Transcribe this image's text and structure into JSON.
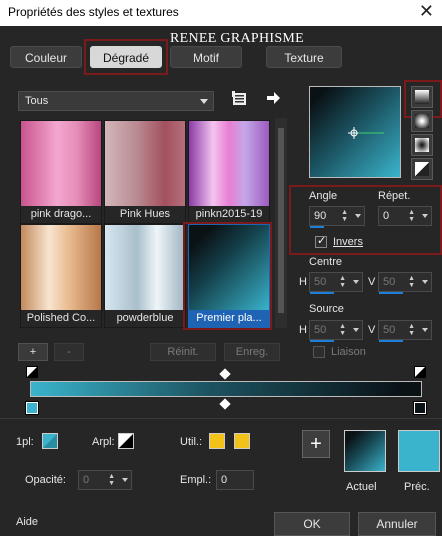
{
  "window": {
    "title": "Propriétés des styles et textures",
    "close_glyph": "✕"
  },
  "watermark": "RENEE GRAPHISME",
  "tabs": [
    {
      "label": "Couleur"
    },
    {
      "label": "Dégradé"
    },
    {
      "label": "Motif"
    },
    {
      "label": "Texture"
    }
  ],
  "category": {
    "value": "Tous"
  },
  "gradients": [
    {
      "name": "pink drago..."
    },
    {
      "name": "Pink Hues"
    },
    {
      "name": "pinkn2015-19"
    },
    {
      "name": "Polished Co..."
    },
    {
      "name": "powderblue"
    },
    {
      "name": "Premier pla..."
    }
  ],
  "gradient_buttons": {
    "add": "+",
    "remove": "-",
    "reset": "Réinit.",
    "save": "Enreg."
  },
  "angle": {
    "label": "Angle",
    "value": "90"
  },
  "repeat": {
    "label": "Répet.",
    "value": "0"
  },
  "invert": {
    "label": "Invers",
    "checked": true
  },
  "center": {
    "label": "Centre",
    "h_label": "H",
    "h_value": "50",
    "v_label": "V",
    "v_value": "50"
  },
  "source": {
    "label": "Source",
    "h_label": "H",
    "h_value": "50",
    "v_label": "V",
    "v_value": "50"
  },
  "link": {
    "label": "Liaison"
  },
  "stop": {
    "first_label": "1pl:",
    "arpl_label": "Arpl:",
    "util_label": "Util.:",
    "opacity_label": "Opacité:",
    "opacity_value": "0",
    "location_label": "Empl.:",
    "location_value": "0"
  },
  "preview": {
    "current_label": "Actuel",
    "previous_label": "Préc.",
    "add_glyph": "+"
  },
  "footer": {
    "help": "Aide",
    "ok": "OK",
    "cancel": "Annuler"
  },
  "colors": {
    "teal": "#3ab4cc",
    "dark": "#0a1216",
    "selected": "#1f63b4",
    "highlight_box": "#7a1a1a",
    "swatch_yellow": "#f2c21b"
  },
  "icons": [
    "library-icon",
    "arrow-right-icon",
    "linear-gradient-icon",
    "radial-gradient-icon",
    "rectangular-gradient-icon",
    "sunburst-gradient-icon"
  ]
}
